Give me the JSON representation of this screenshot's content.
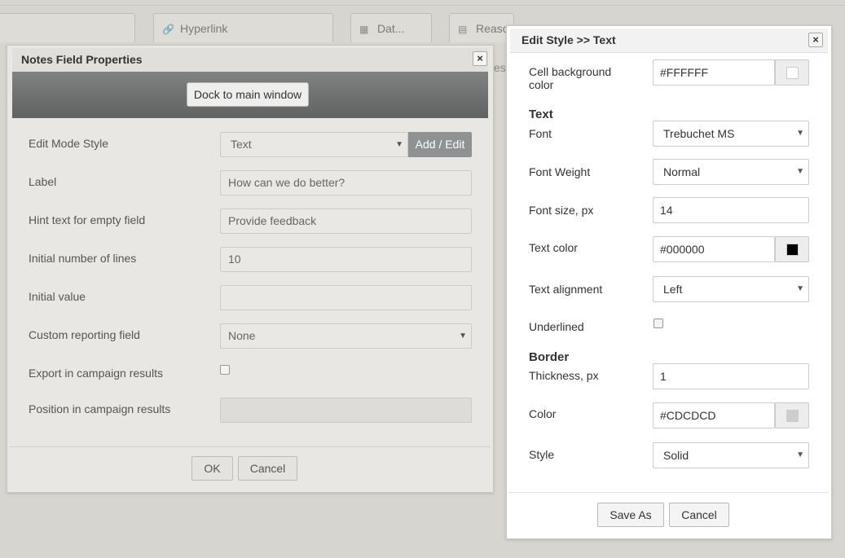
{
  "background": {
    "tabs": [
      {
        "icon": "link-icon",
        "glyph": "🔗",
        "label": "Hyperlink"
      },
      {
        "icon": "date-icon",
        "glyph": "▦",
        "label": "Dat..."
      },
      {
        "icon": "archive-icon",
        "glyph": "▤",
        "label": "Reaso"
      }
    ],
    "fragment": "es"
  },
  "notes_dialog": {
    "title": "Notes Field Properties",
    "close": "×",
    "dock_button": "Dock to main window",
    "fields": {
      "edit_mode_style": {
        "label": "Edit Mode Style",
        "value": "Text",
        "button": "Add / Edit"
      },
      "label": {
        "label": "Label",
        "value": "How can we do better?"
      },
      "hint_text": {
        "label": "Hint text for empty field",
        "value": "Provide feedback"
      },
      "initial_lines": {
        "label": "Initial number of lines",
        "value": "10"
      },
      "initial_value": {
        "label": "Initial value",
        "value": ""
      },
      "custom_reporting": {
        "label": "Custom reporting field",
        "value": "None"
      },
      "export": {
        "label": "Export in campaign results",
        "checked": false
      },
      "position": {
        "label": "Position in campaign results",
        "value": ""
      }
    },
    "ok": "OK",
    "cancel": "Cancel"
  },
  "style_dialog": {
    "title": "Edit Style >> Text",
    "close": "×",
    "cell_bg": {
      "label": "Cell background color",
      "value": "#FFFFFF",
      "swatch": "#FFFFFF"
    },
    "text_section": "Text",
    "font": {
      "label": "Font",
      "value": "Trebuchet MS"
    },
    "font_weight": {
      "label": "Font Weight",
      "value": "Normal"
    },
    "font_size": {
      "label": "Font size, px",
      "value": "14"
    },
    "text_color": {
      "label": "Text color",
      "value": "#000000",
      "swatch": "#000000"
    },
    "text_alignment": {
      "label": "Text alignment",
      "value": "Left"
    },
    "underlined": {
      "label": "Underlined",
      "checked": false
    },
    "border_section": "Border",
    "thickness": {
      "label": "Thickness, px",
      "value": "1"
    },
    "color": {
      "label": "Color",
      "value": "#CDCDCD",
      "swatch": "#CDCDCD"
    },
    "style": {
      "label": "Style",
      "value": "Solid"
    },
    "save_as": "Save As",
    "cancel": "Cancel"
  }
}
